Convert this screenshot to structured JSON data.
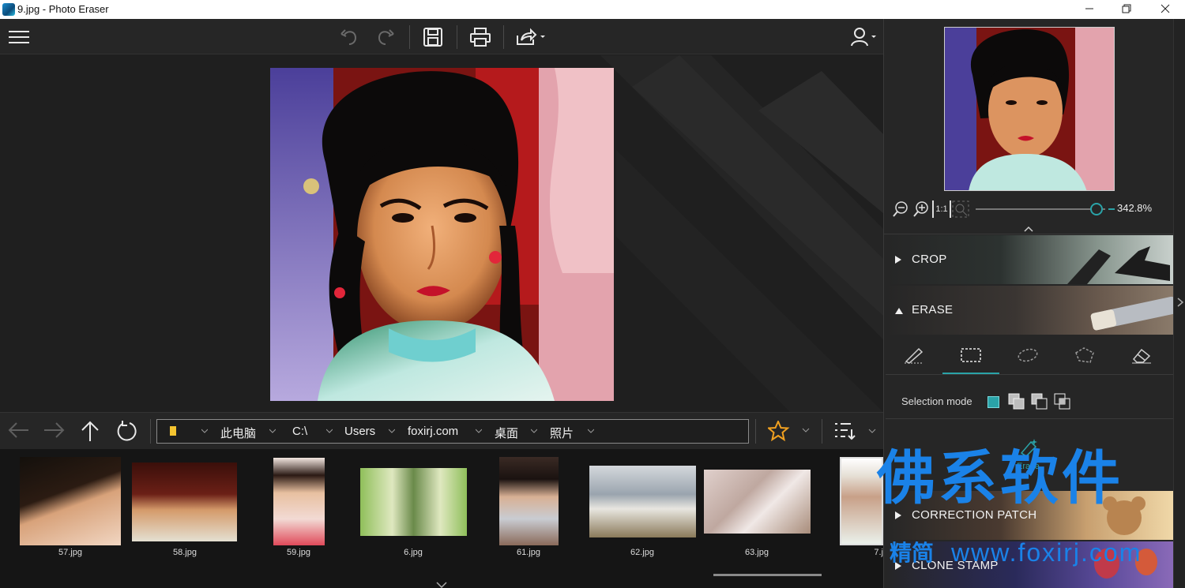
{
  "window": {
    "title": "9.jpg - Photo Eraser"
  },
  "toolbar": {
    "menu_icon": "hamburger-icon",
    "undo_icon": "undo-icon",
    "redo_icon": "redo-icon",
    "save_icon": "save-icon",
    "print_icon": "print-icon",
    "share_icon": "share-icon",
    "account_icon": "user-icon"
  },
  "nav": {
    "back_icon": "arrow-left-icon",
    "forward_icon": "arrow-right-icon",
    "up_icon": "arrow-up-icon",
    "refresh_icon": "refresh-icon",
    "breadcrumbs": [
      "此电脑",
      "C:\\",
      "Users",
      "foxirj.com",
      "桌面",
      "照片"
    ],
    "favorite_icon": "star-icon",
    "view_icon": "list-sort-icon"
  },
  "thumbnails": [
    "57.jpg",
    "58.jpg",
    "59.jpg",
    "6.jpg",
    "61.jpg",
    "62.jpg",
    "63.jpg",
    "7.j"
  ],
  "zoom": {
    "value": "342.8%",
    "slider_level": 0.98,
    "fit_label": "1:1"
  },
  "sections": {
    "crop": "CROP",
    "erase": "ERASE",
    "correction_patch": "CORRECTION PATCH",
    "clone_stamp": "CLONE STAMP"
  },
  "erase": {
    "selection_mode_label": "Selection mode",
    "action_label": "Erase"
  },
  "watermark": {
    "main": "佛系软件",
    "sub_cn": "精简",
    "sub_url": "www.foxirj.com"
  },
  "colors": {
    "accent": "#2aa3a8",
    "watermark": "#1a82e8"
  }
}
